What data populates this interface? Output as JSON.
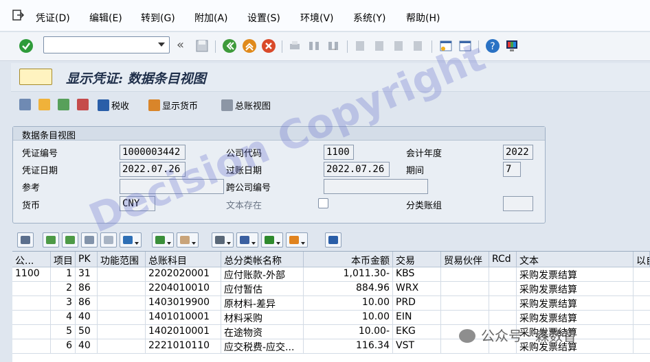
{
  "menubar": {
    "items": [
      "凭证(D)",
      "编辑(E)",
      "转到(G)",
      "附加(A)",
      "设置(S)",
      "环境(V)",
      "系统(Y)",
      "帮助(H)"
    ]
  },
  "toolbar": {
    "command_value": "",
    "nav_glyph": "«"
  },
  "title": {
    "text": "显示凭证: 数据条目视图"
  },
  "app_toolbar": {
    "tax_label": "税收",
    "currency_label": "显示货币",
    "gl_view_label": "总账视图"
  },
  "header": {
    "group_title": "数据条目视图",
    "doc_number_label": "凭证编号",
    "doc_number": "1000003442",
    "company_code_label": "公司代码",
    "company_code": "1100",
    "fiscal_year_label": "会计年度",
    "fiscal_year": "2022",
    "doc_date_label": "凭证日期",
    "doc_date": "2022.07.26",
    "posting_date_label": "过账日期",
    "posting_date": "2022.07.26",
    "period_label": "期间",
    "period": "7",
    "reference_label": "参考",
    "reference": "",
    "cross_cc_label": "跨公司编号",
    "cross_cc": "",
    "currency_label": "货币",
    "currency": "CNY",
    "text_exists_label": "文本存在",
    "ledger_group_label": "分类账组",
    "ledger_group": ""
  },
  "grid": {
    "columns": [
      "公...",
      "项目",
      "PK",
      "功能范围",
      "总账科目",
      "总分类帐名称",
      "本币金额",
      "交易",
      "贸易伙伴",
      "RCd",
      "文本",
      "以自"
    ],
    "rows": [
      {
        "cc": "1100",
        "item": "1",
        "pk": "31",
        "func": "",
        "gl": "2202020001",
        "name": "应付账款-外部",
        "amount": "1,011.30-",
        "trans": "KBS",
        "partner": "",
        "rcd": "",
        "text": "采购发票结算"
      },
      {
        "cc": "",
        "item": "2",
        "pk": "86",
        "func": "",
        "gl": "2204010010",
        "name": "应付暂估",
        "amount": "884.96",
        "trans": "WRX",
        "partner": "",
        "rcd": "",
        "text": "采购发票结算"
      },
      {
        "cc": "",
        "item": "3",
        "pk": "86",
        "func": "",
        "gl": "1403019900",
        "name": "原材料-差异",
        "amount": "10.00",
        "trans": "PRD",
        "partner": "",
        "rcd": "",
        "text": "采购发票结算"
      },
      {
        "cc": "",
        "item": "4",
        "pk": "40",
        "func": "",
        "gl": "1401010001",
        "name": "材料采购",
        "amount": "10.00",
        "trans": "EIN",
        "partner": "",
        "rcd": "",
        "text": "采购发票结算"
      },
      {
        "cc": "",
        "item": "5",
        "pk": "50",
        "func": "",
        "gl": "1402010001",
        "name": "在途物资",
        "amount": "10.00-",
        "trans": "EKG",
        "partner": "",
        "rcd": "",
        "text": "采购发票结算"
      },
      {
        "cc": "",
        "item": "6",
        "pk": "40",
        "func": "",
        "gl": "2221010110",
        "name": "应交税费-应交...",
        "amount": "116.34",
        "trans": "VST",
        "partner": "",
        "rcd": "",
        "text": "采购发票结算"
      }
    ]
  },
  "watermark": {
    "text": "Decision Copyright"
  },
  "footer": {
    "brand": "公众号 · 森数智"
  },
  "colors": {
    "enter": "#2e9b3a",
    "back": "#3e9a3a",
    "exit": "#e08a1c",
    "cancel": "#d94a2a",
    "help": "#2a72c4"
  }
}
